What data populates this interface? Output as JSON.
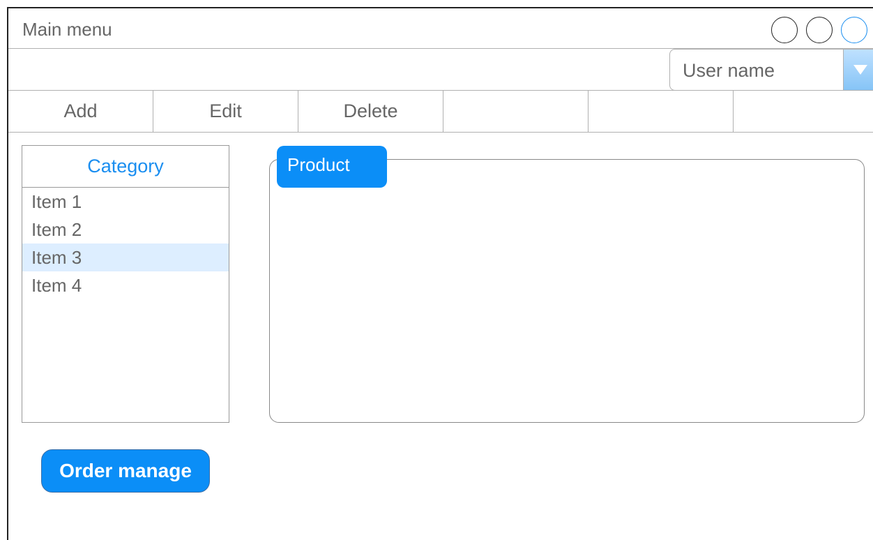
{
  "window": {
    "title": "Main menu",
    "controls": [
      "minimize-button",
      "maximize-button",
      "close-button"
    ]
  },
  "user": {
    "selected": "User name"
  },
  "toolbar": {
    "buttons": [
      {
        "label": "Add"
      },
      {
        "label": "Edit"
      },
      {
        "label": "Delete"
      },
      {
        "label": ""
      },
      {
        "label": ""
      },
      {
        "label": ""
      }
    ]
  },
  "category": {
    "header": "Category",
    "items": [
      {
        "label": "Item 1",
        "selected": false
      },
      {
        "label": "Item 2",
        "selected": false
      },
      {
        "label": "Item 3",
        "selected": true
      },
      {
        "label": "Item 4",
        "selected": false
      }
    ]
  },
  "product": {
    "tab_label": "Product"
  },
  "actions": {
    "order_manage": "Order manage"
  },
  "colors": {
    "accent": "#0b8ef7",
    "selection": "#ddeeff",
    "text": "#666666"
  }
}
